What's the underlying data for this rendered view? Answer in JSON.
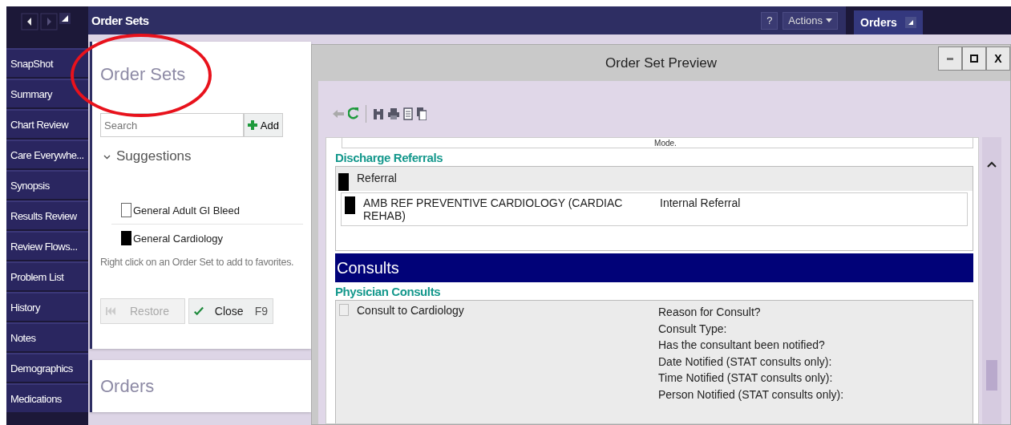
{
  "annotation_circle": true,
  "nav": {
    "items": [
      {
        "label": "SnapShot"
      },
      {
        "label": "Summary"
      },
      {
        "label": "Chart Review"
      },
      {
        "label": "Care Everywhe..."
      },
      {
        "label": "Synopsis"
      },
      {
        "label": "Results Review"
      },
      {
        "label": "Review Flows..."
      },
      {
        "label": "Problem List"
      },
      {
        "label": "History"
      },
      {
        "label": "Notes"
      },
      {
        "label": "Demographics"
      },
      {
        "label": "Medications"
      }
    ]
  },
  "header": {
    "title": "Order Sets",
    "help": "?",
    "actions": "Actions"
  },
  "orders_tab": {
    "label": "Orders",
    "selected": true
  },
  "order_sets_panel": {
    "title": "Order Sets",
    "search": {
      "placeholder": "Search"
    },
    "add_button": "Add",
    "suggestions": {
      "label": "Suggestions",
      "expanded": true,
      "items": [
        {
          "label": "General Adult GI Bleed",
          "checked": false
        },
        {
          "label": "General Cardiology",
          "checked": true
        }
      ]
    },
    "hint": "Right click on an Order Set to add to favorites.",
    "buttons": [
      {
        "kind": "restore",
        "label": "Restore",
        "disabled": true
      },
      {
        "kind": "close",
        "label": "Close",
        "shortcut": "F9",
        "disabled": false
      }
    ]
  },
  "orders_panel": {
    "title": "Orders"
  },
  "preview": {
    "title": "Order Set Preview",
    "close": "X",
    "cut_text": "Mode.",
    "sections": [
      {
        "kind": "subheading",
        "label": "Discharge Referrals"
      },
      {
        "kind": "group",
        "label": "Referral",
        "checked": true,
        "orders": [
          {
            "name": "AMB REF PREVENTIVE CARDIOLOGY (CARDIAC REHAB)",
            "detail": "Internal Referral",
            "checked": true
          }
        ]
      },
      {
        "kind": "section",
        "label": "Consults"
      },
      {
        "kind": "subheading",
        "label": "Physician Consults"
      },
      {
        "kind": "order",
        "label": "Consult to Cardiology",
        "checked": false,
        "questions": [
          "Reason for Consult?",
          "Consult Type:",
          "Has the consultant been notified?",
          "Date Notified (STAT consults only):",
          "Time Notified (STAT consults only):",
          "Person Notified (STAT consults only):"
        ]
      }
    ]
  }
}
